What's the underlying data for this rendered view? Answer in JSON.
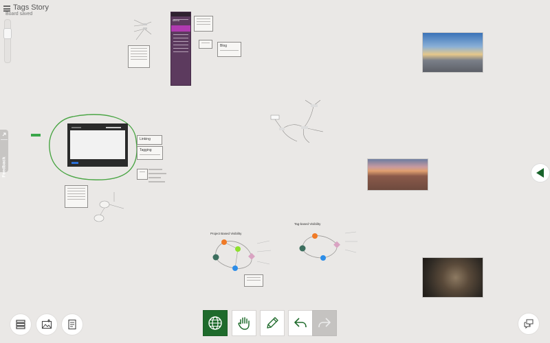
{
  "app": {
    "title": "Tags Story",
    "status": "Board saved"
  },
  "feedback_tab": {
    "label": "Feedback",
    "icon": "arrow-icon"
  },
  "notes": {
    "linking": "Linking",
    "tagging": "Tagging",
    "blog": "Blog"
  },
  "sidebar": {
    "header": "Menu"
  },
  "diagrams": {
    "left_title": "Project Based Visibility",
    "right_title": "Tag-based Visibility"
  },
  "toolbar": {
    "left": [
      "layers-icon",
      "image-upload-icon",
      "notes-icon"
    ],
    "center": [
      "globe-icon",
      "hand-icon",
      "pencil-icon",
      "undo-icon",
      "redo-icon"
    ],
    "right": [
      "chat-icon"
    ]
  },
  "colors": {
    "brand_green": "#1f6b2c",
    "canvas_bg": "#eae8e6",
    "purple_panel": "#5c3a5e",
    "node_orange": "#f07a26",
    "node_lime": "#8ee02e",
    "node_pink": "#d9a3c2",
    "node_blue": "#2c8de8",
    "node_teal": "#3c6e5e"
  }
}
